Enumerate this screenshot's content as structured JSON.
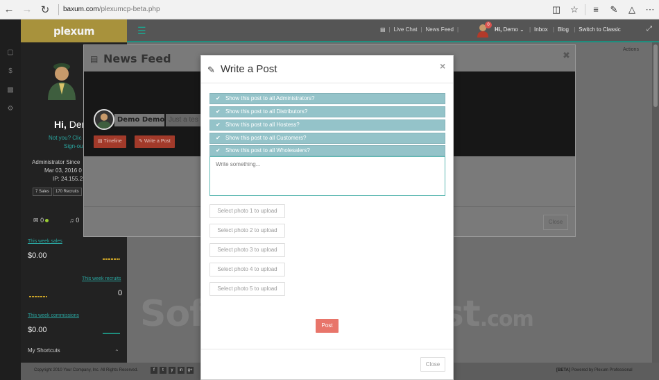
{
  "browser": {
    "url_host": "baxum.com",
    "url_path": "/plexumcp-beta.php"
  },
  "sidebar": {
    "logo": "plexum",
    "greeting_hi": "Hi,",
    "greeting_name": " Dem",
    "not_you": "Not you? Clic",
    "sign_out": "Sign-ou",
    "admin_since": "Administrator Since",
    "date": "Mar 03, 2016 0",
    "ip": "IP: 24.155.2",
    "badges": [
      "7 Sales",
      "170 Recruits"
    ],
    "messages_count": "0",
    "alerts_count": "0",
    "stats": [
      {
        "label": "This week sales",
        "value": "$0.00"
      },
      {
        "label": "This week recruits",
        "value": "0"
      },
      {
        "label": "This week commissions",
        "value": "$0.00"
      }
    ],
    "shortcuts": "My Shortcuts"
  },
  "topnav": {
    "items": [
      "Live Chat",
      "News Feed"
    ],
    "notif_count": "0",
    "user_hi": "Hi,",
    "user_name": " Demo",
    "items_right": [
      "Inbox",
      "Blog",
      "Switch to Classic"
    ],
    "actions": "Actions"
  },
  "news_feed": {
    "title": "News Feed",
    "profile_name": "Demo Demo",
    "status_placeholder": "Just a tes",
    "timeline_btn": "Timeline",
    "write_post_btn": "Write a Post",
    "close_btn": "Close"
  },
  "write_post": {
    "title": "Write a Post",
    "options": [
      "Show this post to all Administrators?",
      "Show this post to all Distributors?",
      "Show this post to all Hostess?",
      "Show this post to all Customers?",
      "Show this post to all Wholesalers?"
    ],
    "textarea_placeholder": "Write something...",
    "photo_buttons": [
      "Select photo 1 to upload",
      "Select photo 2 to upload",
      "Select photo 3 to upload",
      "Select photo 4 to upload",
      "Select photo 5 to upload"
    ],
    "post_btn": "Post",
    "close_btn": "Close"
  },
  "footer": {
    "copyright": "Copyright 2010 Your Company, Inc. All Rights Reserved.",
    "social": [
      "f",
      "t",
      "y",
      "in",
      "g+"
    ],
    "beta": "[BETA]",
    "powered": "Powered by Plexum Professional"
  },
  "watermark": {
    "main": "SoftwareSuggest",
    "suffix": ".com"
  },
  "colors": {
    "accent_teal": "#1e8e7e",
    "option_bg": "#94c3c9",
    "post_btn": "#e8756a",
    "logo_bg": "#a8923c"
  }
}
